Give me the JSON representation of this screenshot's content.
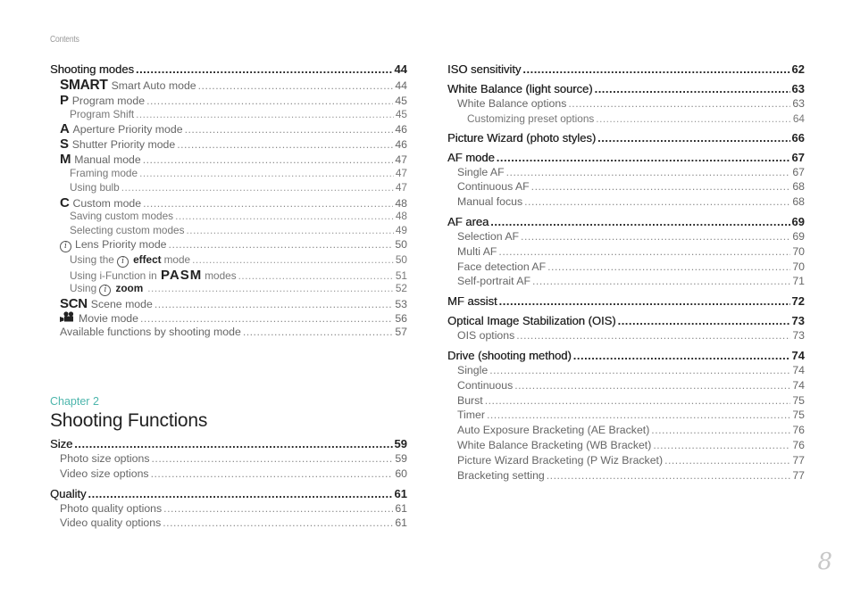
{
  "header": {
    "label": "Contents"
  },
  "page_number": "8",
  "left_column": {
    "sections": [
      {
        "title": "Shooting modes",
        "page": "44",
        "children": [
          {
            "icon": "SMART",
            "label": "Smart Auto mode",
            "page": "44"
          },
          {
            "icon": "P",
            "label": "Program mode",
            "page": "45",
            "children": [
              {
                "label": "Program Shift",
                "page": "45"
              }
            ]
          },
          {
            "icon": "A",
            "label": "Aperture Priority mode",
            "page": "46"
          },
          {
            "icon": "S",
            "label": "Shutter Priority mode",
            "page": "46"
          },
          {
            "icon": "M",
            "label": "Manual mode",
            "page": "47",
            "children": [
              {
                "label": "Framing mode",
                "page": "47"
              },
              {
                "label": "Using bulb",
                "page": "47"
              }
            ]
          },
          {
            "icon": "C",
            "label": "Custom mode",
            "page": "48",
            "children": [
              {
                "label": "Saving custom modes",
                "page": "48"
              },
              {
                "label": "Selecting custom modes",
                "page": "49"
              }
            ]
          },
          {
            "icon": "i",
            "label": "Lens Priority mode",
            "page": "50",
            "children": [
              {
                "prefix": "Using the",
                "icon": "i",
                "bold": "effect",
                "suffix": "mode",
                "page": "50"
              },
              {
                "prefix": "Using i-Function in",
                "bold": "PASM",
                "suffix": "modes",
                "page": "51"
              },
              {
                "prefix": "Using",
                "icon": "i",
                "bold": "zoom",
                "suffix": "",
                "page": "52"
              }
            ]
          },
          {
            "icon": "SCN",
            "label": "Scene mode",
            "page": "53"
          },
          {
            "icon": "movie",
            "label": "Movie mode",
            "page": "56"
          },
          {
            "label": "Available functions by shooting mode",
            "page": "57"
          }
        ]
      }
    ]
  },
  "chapter": {
    "label": "Chapter 2",
    "title": "Shooting Functions",
    "sections": [
      {
        "title": "Size",
        "page": "59",
        "children": [
          {
            "label": "Photo size options",
            "page": "59"
          },
          {
            "label": "Video size options",
            "page": "60"
          }
        ]
      },
      {
        "title": "Quality",
        "page": "61",
        "children": [
          {
            "label": "Photo quality options",
            "page": "61"
          },
          {
            "label": "Video quality options",
            "page": "61"
          }
        ]
      }
    ]
  },
  "right_column": {
    "sections": [
      {
        "title": "ISO sensitivity",
        "page": "62",
        "children": []
      },
      {
        "title": "White Balance (light source)",
        "page": "63",
        "children": [
          {
            "label": "White Balance options",
            "page": "63",
            "children": [
              {
                "label": "Customizing preset options",
                "page": "64"
              }
            ]
          }
        ]
      },
      {
        "title": "Picture Wizard (photo styles)",
        "page": "66",
        "children": []
      },
      {
        "title": "AF mode",
        "page": "67",
        "children": [
          {
            "label": "Single AF",
            "page": "67"
          },
          {
            "label": "Continuous AF",
            "page": "68"
          },
          {
            "label": "Manual focus",
            "page": "68"
          }
        ]
      },
      {
        "title": "AF area",
        "page": "69",
        "children": [
          {
            "label": "Selection AF",
            "page": "69"
          },
          {
            "label": "Multi AF",
            "page": "70"
          },
          {
            "label": "Face detection AF",
            "page": "70"
          },
          {
            "label": "Self-portrait AF",
            "page": "71"
          }
        ]
      },
      {
        "title": "MF assist",
        "page": "72",
        "children": []
      },
      {
        "title": "Optical Image Stabilization (OIS)",
        "page": "73",
        "children": [
          {
            "label": "OIS options",
            "page": "73"
          }
        ]
      },
      {
        "title": "Drive (shooting method)",
        "page": "74",
        "children": [
          {
            "label": "Single",
            "page": "74"
          },
          {
            "label": "Continuous",
            "page": "74"
          },
          {
            "label": "Burst",
            "page": "75"
          },
          {
            "label": "Timer",
            "page": "75"
          },
          {
            "label": "Auto Exposure Bracketing (AE Bracket)",
            "page": "76"
          },
          {
            "label": "White Balance Bracketing (WB Bracket)",
            "page": "76"
          },
          {
            "label": "Picture Wizard Bracketing (P Wiz Bracket)",
            "page": "77"
          },
          {
            "label": "Bracketing setting",
            "page": "77"
          }
        ]
      }
    ]
  },
  "colors": {
    "accent": "#4db6ac",
    "heading": "#222222",
    "subtext": "#666666",
    "page_number": "#c8c8c8"
  }
}
